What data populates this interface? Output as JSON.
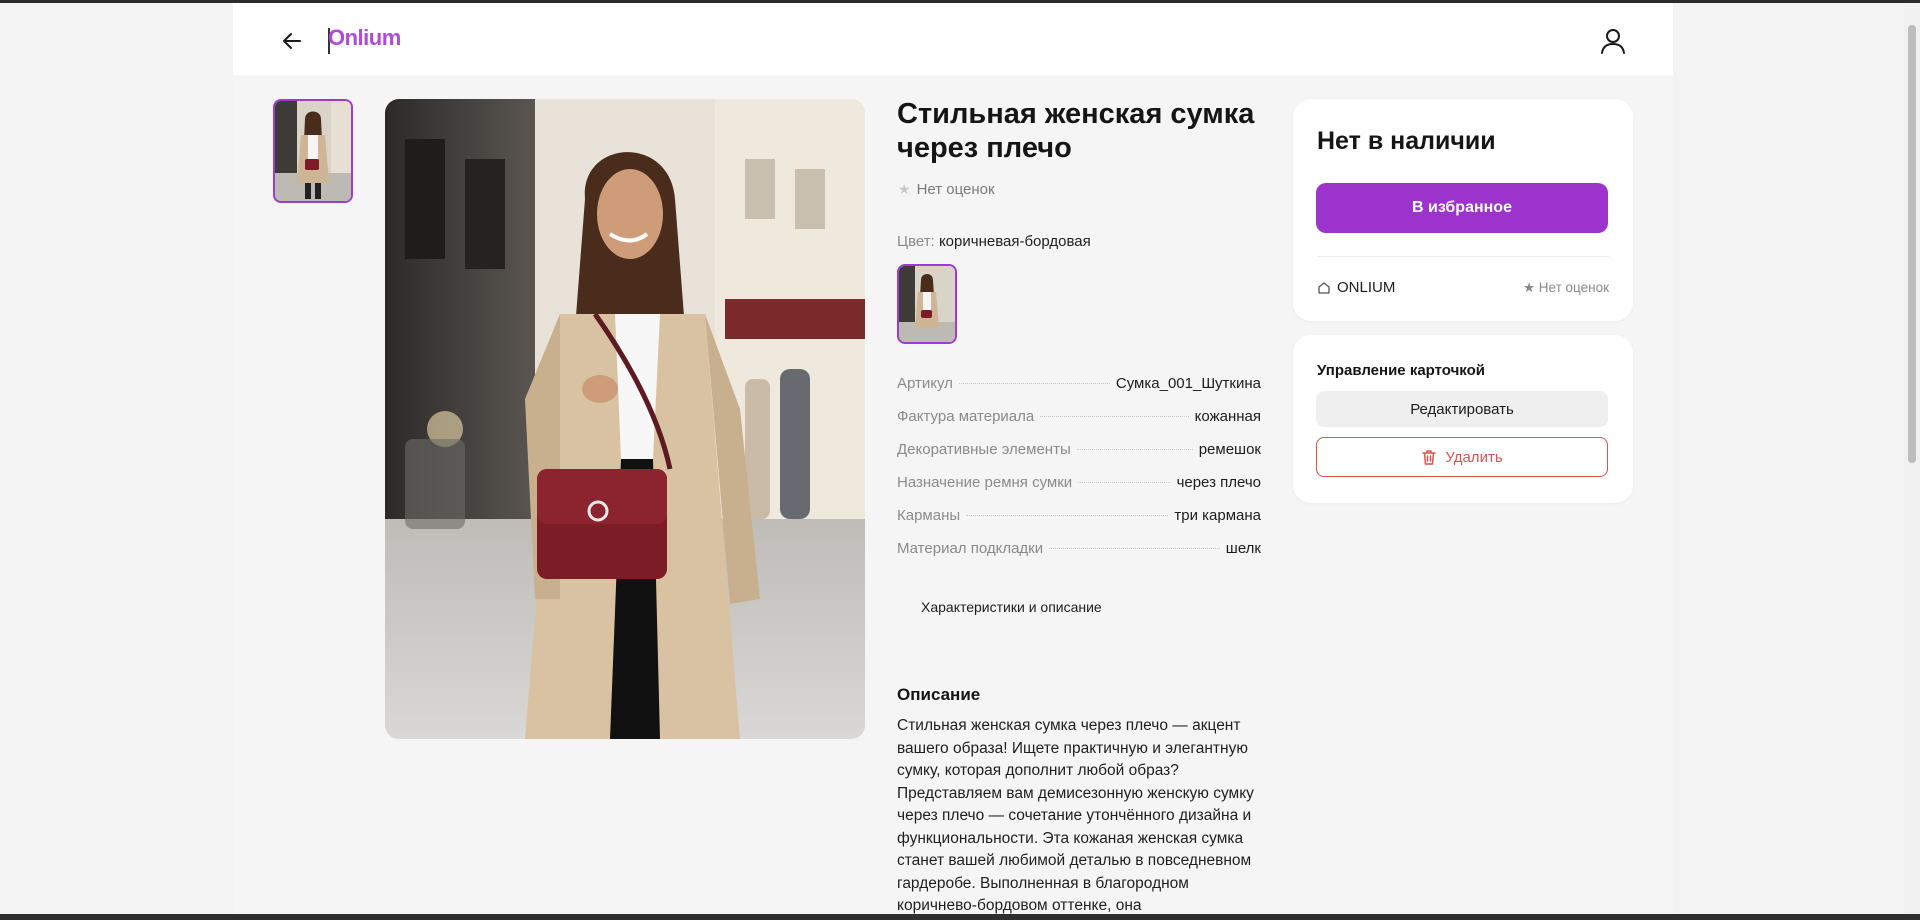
{
  "header": {
    "back_icon": "arrow-left-icon",
    "logo": "Onlium",
    "user_icon": "user-icon"
  },
  "product": {
    "title": "Стильная женская сумка через плечо",
    "rating_text": "Нет оценок",
    "color_label": "Цвет:",
    "color_value": "коричневая-бордовая",
    "specs": [
      {
        "key": "Артикул",
        "value": "Сумка_001_Шуткина"
      },
      {
        "key": "Фактура материала",
        "value": "кожанная"
      },
      {
        "key": "Декоративные элементы",
        "value": "ремешок"
      },
      {
        "key": "Назначение ремня сумки",
        "value": "через плечо"
      },
      {
        "key": "Карманы",
        "value": "три кармана"
      },
      {
        "key": "Материал подкладки",
        "value": "шелк"
      }
    ],
    "characteristics_link": "Характеристики и описание",
    "description_title": "Описание",
    "description_text": "Стильная женская сумка через плечо — акцент вашего образа! Ищете практичную и элегантную сумку, которая дополнит любой образ? Представляем вам демисезонную женскую сумку через плечо — сочетание утончённого дизайна и функциональности. Эта кожаная женская сумка станет вашей любимой деталью в повседневном гардеробе. Выполненная в благородном коричнево-бордовом оттенке, она"
  },
  "purchase_card": {
    "stock_status": "Нет в наличии",
    "favorite_button": "В избранное",
    "seller_name": "ONLIUM",
    "seller_rating": "★ Нет оценок"
  },
  "manage_card": {
    "title": "Управление карточкой",
    "edit_button": "Редактировать",
    "delete_button": "Удалить"
  },
  "colors": {
    "accent": "#9b33cc",
    "logo": "#b04bd6",
    "danger": "#d9534f"
  }
}
